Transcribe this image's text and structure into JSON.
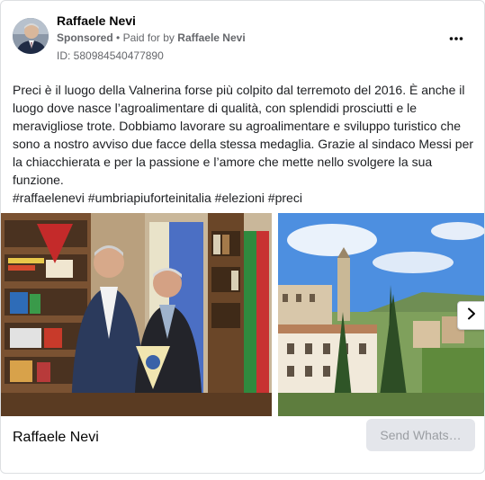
{
  "post": {
    "author": "Raffaele Nevi",
    "sponsored_label": "Sponsored",
    "separator": "•",
    "paid_for_prefix": "Paid for by",
    "paid_for_by": "Raffaele Nevi",
    "ad_id": "ID: 580984540477890",
    "more_icon": "more-horizontal-icon",
    "text": "Preci è il luogo della Valnerina forse più colpito dal terremoto del 2016. È anche il luogo dove nasce l’agroalimentare di qualità, con splendidi prosciutti e le meravigliose trote. Dobbiamo lavorare su agroalimentare e sviluppo turistico che sono a nostro avviso due facce della stessa medaglia. Grazie al sindaco Messi per la chiacchierata e per la passione e l’amore che mette nello svolgere la sua funzione.",
    "hashtags": "#raffaelenevi #umbriapiuforteinitalia #elezioni #preci"
  },
  "carousel": {
    "next_icon": "chevron-right-icon",
    "slides": [
      {
        "name": "office-meeting-photo"
      },
      {
        "name": "preci-village-photo"
      }
    ]
  },
  "footer": {
    "page_name": "Raffaele Nevi",
    "cta_label": "Send Whats…"
  },
  "colors": {
    "secondary_text": "#65676b",
    "border": "#dddfe2",
    "cta_bg": "#e4e6eb",
    "cta_text": "#9b9ea3"
  }
}
